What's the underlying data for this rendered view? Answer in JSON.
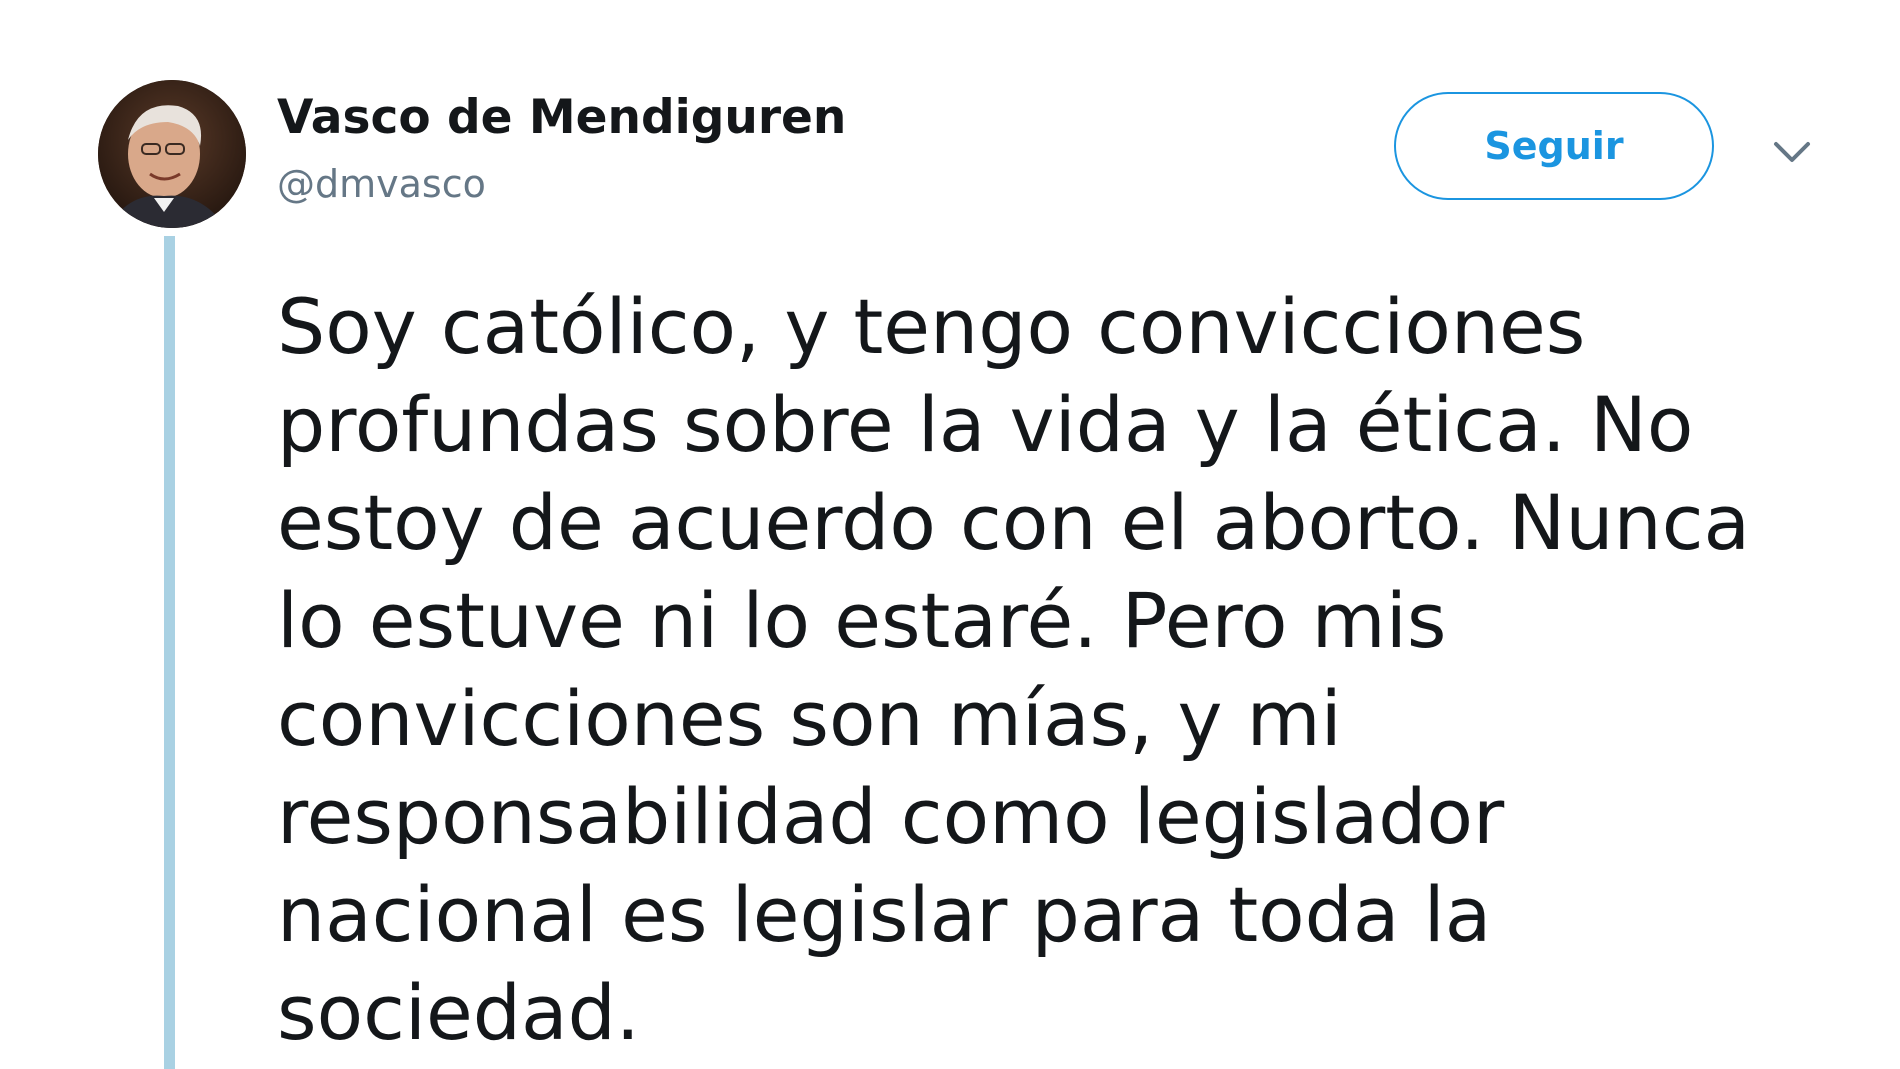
{
  "author": {
    "display_name": "Vasco de Mendiguren",
    "handle": "@dmvasco"
  },
  "actions": {
    "follow_label": "Seguir",
    "menu_icon": "chevron-down-icon"
  },
  "tweet": {
    "lines": [
      "Soy católico, y tengo convicciones",
      "profundas sobre la vida y la ética. No",
      "estoy de acuerdo con el aborto. Nunca",
      "lo estuve ni lo estaré. Pero mis",
      "convicciones son mías, y mi",
      "responsabilidad como legislador",
      "nacional es legislar para toda la",
      "sociedad."
    ]
  },
  "colors": {
    "accent": "#1b95e0",
    "thread_line": "#a9d1e3",
    "text": "#14171a",
    "secondary_text": "#657786"
  }
}
